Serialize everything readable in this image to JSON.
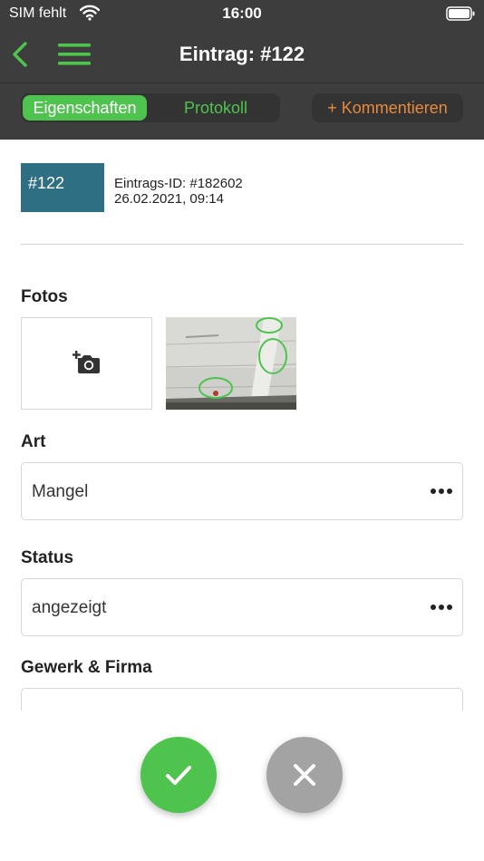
{
  "status_bar": {
    "carrier": "SIM fehlt",
    "time": "16:00"
  },
  "nav": {
    "title": "Eintrag: #122",
    "back_icon": "chevron-left-icon",
    "menu_icon": "hamburger-menu-icon"
  },
  "tabs": {
    "items": [
      {
        "label": "Eigenschaften",
        "active": true
      },
      {
        "label": "Protokoll",
        "active": false
      }
    ],
    "comment_label": "+ Kommentieren"
  },
  "entry": {
    "badge": "#122",
    "id_line": "Eintrags-ID: #182602",
    "date_line": "26.02.2021, 09:14"
  },
  "sections": {
    "photos_label": "Fotos",
    "type_label": "Art",
    "type_value": "Mangel",
    "status_label": "Status",
    "status_value": "angezeigt",
    "trade_label": "Gewerk & Firma"
  },
  "actions": {
    "confirm_icon": "checkmark-icon",
    "cancel_icon": "close-icon"
  },
  "colors": {
    "bar_background": "#3d3d3d",
    "accent_green": "#4ec44e",
    "accent_orange": "#e8893c",
    "badge_blue": "#2f6f84",
    "cancel_grey": "#a3a3a3"
  }
}
